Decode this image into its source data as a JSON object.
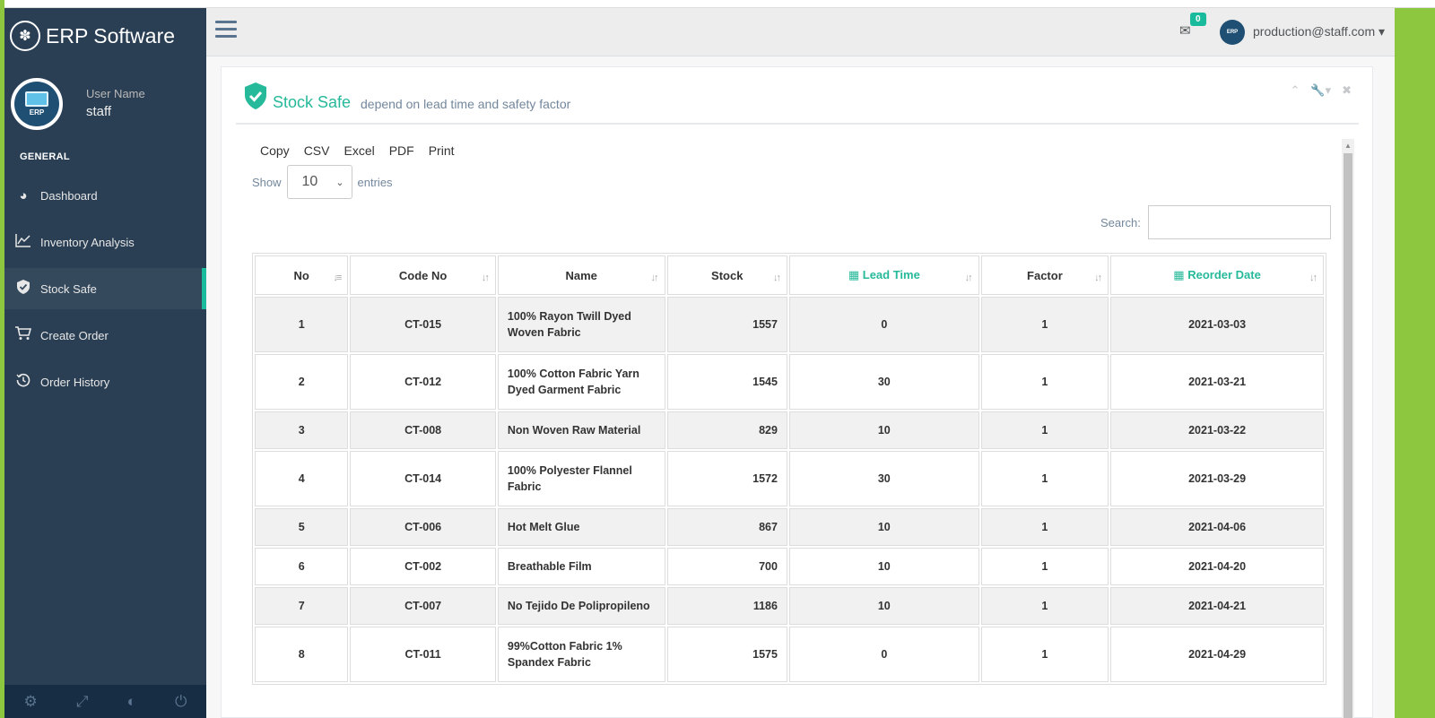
{
  "brand": {
    "title": "ERP Software"
  },
  "profile": {
    "label": "User Name",
    "username": "staff",
    "avatar_text": "ERP"
  },
  "sidebar": {
    "section": "GENERAL",
    "items": [
      {
        "label": "Dashboard",
        "icon": "dashboard-icon"
      },
      {
        "label": "Inventory Analysis",
        "icon": "chart-line-icon"
      },
      {
        "label": "Stock Safe",
        "icon": "shield-check-icon"
      },
      {
        "label": "Create Order",
        "icon": "cart-icon"
      },
      {
        "label": "Order History",
        "icon": "history-icon"
      }
    ],
    "active": "Stock Safe"
  },
  "topnav": {
    "mail_badge": "0",
    "user_email": "production@staff.com"
  },
  "panel": {
    "title": "Stock Safe",
    "subtitle": "depend on lead time and safety factor",
    "buttons": [
      "Copy",
      "CSV",
      "Excel",
      "PDF",
      "Print"
    ],
    "show_label": "Show",
    "entries_value": "10",
    "entries_label": "entries",
    "search_label": "Search:"
  },
  "table": {
    "headers": [
      "No",
      "Code No",
      "Name",
      "Stock",
      "Lead Time",
      "Factor",
      "Reorder Date"
    ],
    "rows": [
      [
        "1",
        "CT-015",
        "100% Rayon Twill Dyed Woven Fabric",
        "1557",
        "0",
        "1",
        "2021-03-03"
      ],
      [
        "2",
        "CT-012",
        "100% Cotton Fabric Yarn Dyed Garment Fabric",
        "1545",
        "30",
        "1",
        "2021-03-21"
      ],
      [
        "3",
        "CT-008",
        "Non Woven Raw Material",
        "829",
        "10",
        "1",
        "2021-03-22"
      ],
      [
        "4",
        "CT-014",
        "100% Polyester Flannel Fabric",
        "1572",
        "30",
        "1",
        "2021-03-29"
      ],
      [
        "5",
        "CT-006",
        "Hot Melt Glue",
        "867",
        "10",
        "1",
        "2021-04-06"
      ],
      [
        "6",
        "CT-002",
        "Breathable Film",
        "700",
        "10",
        "1",
        "2021-04-20"
      ],
      [
        "7",
        "CT-007",
        "No Tejido De Polipropileno",
        "1186",
        "10",
        "1",
        "2021-04-21"
      ],
      [
        "8",
        "CT-011",
        "99%Cotton Fabric 1% Spandex Fabric",
        "1575",
        "0",
        "1",
        "2021-04-29"
      ]
    ]
  },
  "colors": {
    "sidebar": "#2a3f54",
    "accent": "#26b99a",
    "frame": "#8dc63f"
  }
}
